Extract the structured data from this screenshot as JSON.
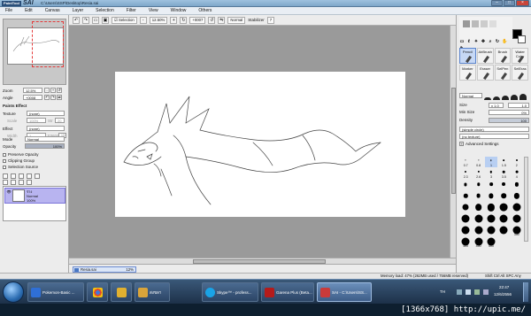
{
  "titlebar": {
    "app_name": "SAI",
    "logo_text": "PaintTool",
    "path": "C:\\Users\\SSP\\Desktop\\Resia.sai"
  },
  "menu": [
    "File",
    "Edit",
    "Canvas",
    "Layer",
    "Selection",
    "Filter",
    "View",
    "Window",
    "Others"
  ],
  "toolbar": {
    "selection_label": "Selection",
    "zoom": "12.50%",
    "rotation": "+0007",
    "mode": "Normal",
    "stabilizer_label": "Stabilizer",
    "stabilizer_value": "7"
  },
  "left": {
    "zoom_label": "Zoom",
    "zoom_value": "12.5%",
    "angle_label": "Angle",
    "angle_value": "+0008",
    "paints_effect": "Paints Effect",
    "texture_label": "Texture",
    "texture_value": "(none)",
    "scale_label": "Scale",
    "scale_value": "100%",
    "strength_label": "Str",
    "strength_value": "20",
    "effect_label": "Effect",
    "effect_value": "(none)",
    "width_label": "Width",
    "width_value": "1",
    "intensity_label": "Intensity",
    "intensity_value": "100",
    "mode_label": "Mode",
    "mode_value": "Normal",
    "opacity_label": "Opacity",
    "opacity_value": "100%",
    "checks": [
      "Preserve Opacity",
      "Clipping Group",
      "Selection Source"
    ],
    "layer_name": "ร่าง",
    "layer_mode": "Normal",
    "layer_opacity": "100%"
  },
  "right": {
    "tools": [
      {
        "label": "Pencil",
        "selected": true
      },
      {
        "label": "AirBrush",
        "selected": false
      },
      {
        "label": "Brush",
        "selected": false
      },
      {
        "label": "Water Color",
        "selected": false
      },
      {
        "label": "Marker",
        "selected": false
      },
      {
        "label": "Eraser",
        "selected": false
      },
      {
        "label": "SelPen",
        "selected": false
      },
      {
        "label": "SelEras",
        "selected": false
      }
    ],
    "blend_mode": "Normal",
    "size_label": "Size",
    "size_mult": "x 1.0",
    "size_value": "1.0",
    "min_size_label": "Min Size",
    "min_size_value": "0%",
    "density_label": "Density",
    "density_value": "100",
    "shape": "(simple circle)",
    "texture": "(no texture)",
    "advanced": "Advanced Settings",
    "brush_sizes": [
      "0.7",
      "0.8",
      "1",
      "1.5",
      "2",
      "2.3",
      "2.6",
      "3",
      "3.5",
      "4",
      "5",
      "6",
      "7",
      "8",
      "9",
      "10",
      "12",
      "14",
      "16",
      "20",
      "25",
      "30",
      "35",
      "40",
      "50",
      "60",
      "70",
      "80",
      "100",
      "120",
      "160",
      "200",
      "250",
      "300",
      "350",
      "400",
      "450",
      "500"
    ],
    "selected_size": "1"
  },
  "document": {
    "tab_name": "Resia.sai",
    "tab_zoom": "12%"
  },
  "status": {
    "memory": "Memory load: 47% (262MB used / 756MB reserved)",
    "keys": "Shift Ctrl Alt SPC Any"
  },
  "taskbar": {
    "items": [
      {
        "label": "Pokemon-Basic ...",
        "color": "#2f6fd6"
      },
      {
        "label": "",
        "color": "#e0482f"
      },
      {
        "label": "",
        "color": "#e0b030"
      },
      {
        "label": "สงขลา",
        "color": "#d9a43a"
      },
      {
        "label": "Skype™ - profess...",
        "color": "#1aa3e6"
      },
      {
        "label": "Garena Plus (Beta...",
        "color": "#b51b1b"
      },
      {
        "label": "SAI - C:\\Users\\SS...",
        "color": "#c93b3b"
      }
    ],
    "lang": "TH",
    "time": "22:47",
    "date": "12/6/2556"
  },
  "watermark": "[1366x768] http://upic.me/"
}
